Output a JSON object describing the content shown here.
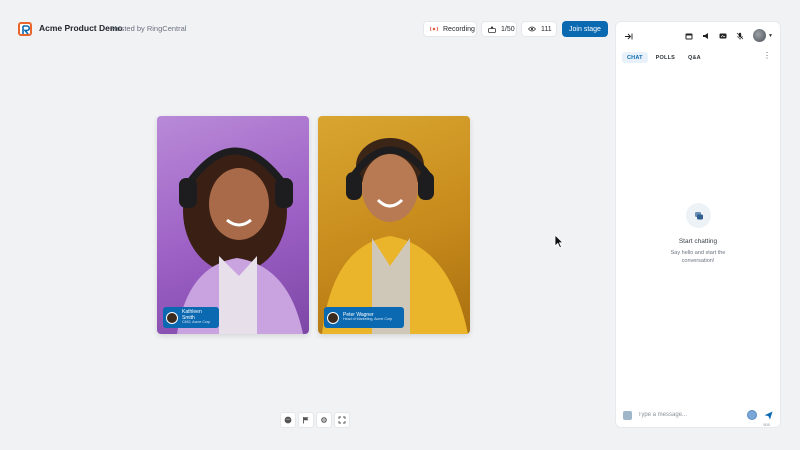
{
  "header": {
    "title": "Acme Product Demo",
    "host": "Hosted by RingCentral",
    "recording_label": "Recording",
    "attendees": "1/50",
    "viewers": "111",
    "join_label": "Join stage"
  },
  "stage": {
    "participants": [
      {
        "name": "Kathleen Smith",
        "role": "CMO, Acme Corp"
      },
      {
        "name": "Peter Wagner",
        "role": "Head of Marketing, Acme Corp"
      }
    ]
  },
  "controls": [
    "emoji-icon",
    "flag-icon",
    "settings-icon",
    "fullscreen-icon"
  ],
  "panel": {
    "tabs": [
      "CHAT",
      "POLLS",
      "Q&A"
    ],
    "empty_title": "Start chatting",
    "empty_subtitle": "Say hello and start the conversation!",
    "composer_placeholder": "Type a message...",
    "char_counter": "500"
  },
  "colors": {
    "accent": "#0b69b1",
    "logo": "#e8652e",
    "recording": "#e0604a"
  }
}
